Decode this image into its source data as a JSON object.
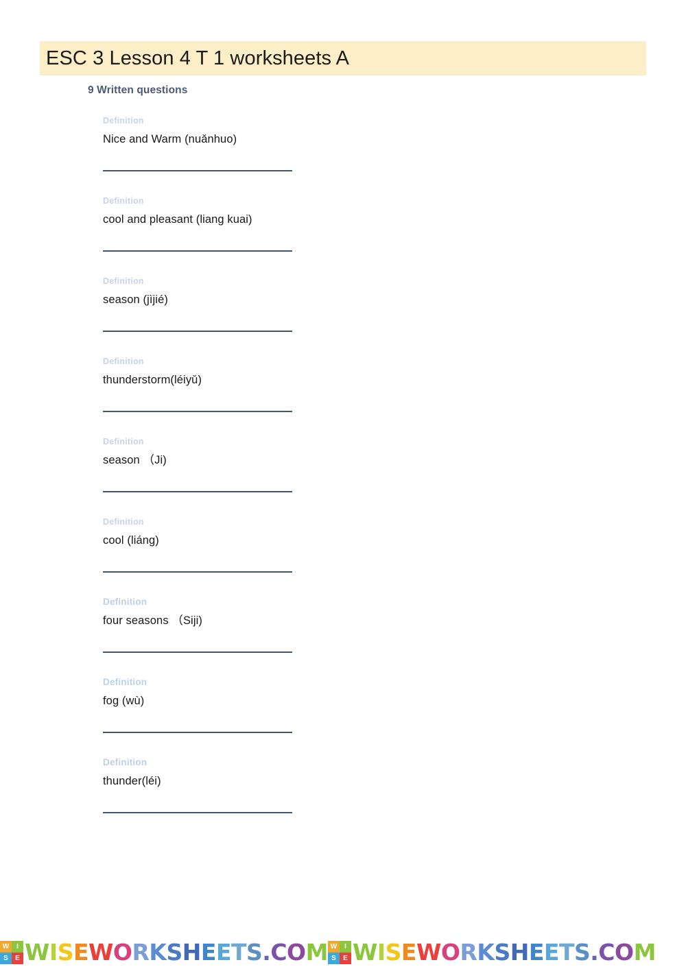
{
  "document": {
    "title": "ESC 3 Lesson 4 T 1 worksheets A",
    "section_heading": "9 Written questions",
    "banner_color": "#fceec6",
    "heading_color": "#4a5a78",
    "label_color": "#c7d4e8",
    "answer_line_color": "#45546e"
  },
  "questions": [
    {
      "label": "Definition",
      "term": "Nice and Warm (nuǎnhuo)"
    },
    {
      "label": "Definition",
      "term": "cool and pleasant (liang kuai)"
    },
    {
      "label": "Definition",
      "term": "season (jìjié)"
    },
    {
      "label": "Definition",
      "term": "thunderstorm(léiyǔ)"
    },
    {
      "label": "Definition",
      "term": "season （Ji)"
    },
    {
      "label": "Definition",
      "term": "cool (liáng)"
    },
    {
      "label": "Definition",
      "term": "four seasons （Siji)"
    },
    {
      "label": "Definition",
      "term": "fog (wù)"
    },
    {
      "label": "Definition",
      "term": "thunder(léi)"
    }
  ],
  "footer": {
    "logo_letters": [
      "W",
      "I",
      "S",
      "E"
    ],
    "logo_colors": [
      "#f0a830",
      "#8cc63f",
      "#3aa9dc",
      "#e8403a"
    ],
    "watermark_text": "WISEWORKSHEETS.COM",
    "repeat_count": 2
  }
}
